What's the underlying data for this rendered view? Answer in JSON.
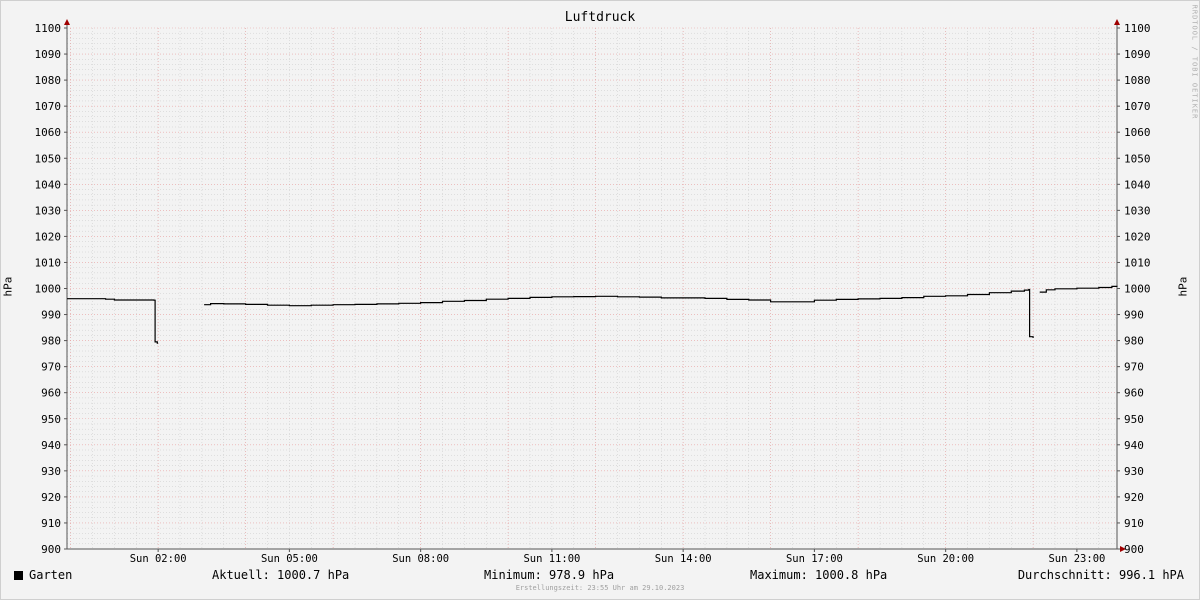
{
  "title": "Luftdruck",
  "watermark": "RRDTOOL / TOBI OETIKER",
  "footer": "Erstellungszeit: 23:55 Uhr am 29.10.2023",
  "legend": {
    "series_name": "Garten",
    "current": "Aktuell: 1000.7 hPa",
    "minimum": "Minimum: 978.9 hPa",
    "maximum": "Maximum: 1000.8 hPa",
    "average": "Durchschnitt: 996.1 hPA"
  },
  "colors": {
    "line": "#000000",
    "major_grid": "#e8a0a0",
    "minor_grid": "#c8c8c8",
    "axis": "#a00000"
  },
  "chart_data": {
    "type": "line",
    "title": "Luftdruck",
    "xlabel": "",
    "ylabel": "hPa",
    "ylabel_right": "hPa",
    "xlim": [
      "23:55",
      "23:55"
    ],
    "ylim": [
      900,
      1100
    ],
    "y_ticks": [
      900,
      910,
      920,
      930,
      940,
      950,
      960,
      970,
      980,
      990,
      1000,
      1010,
      1020,
      1030,
      1040,
      1050,
      1060,
      1070,
      1080,
      1090,
      1100
    ],
    "x_tick_labels": [
      "Sun 02:00",
      "Sun 05:00",
      "Sun 08:00",
      "Sun 11:00",
      "Sun 14:00",
      "Sun 17:00",
      "Sun 20:00",
      "Sun 23:00"
    ],
    "x_tick_hours": [
      2,
      5,
      8,
      11,
      14,
      17,
      20,
      23
    ],
    "x_range_hours": [
      -0.0833,
      23.9167
    ],
    "grid": true,
    "series": [
      {
        "name": "Garten",
        "segments": [
          {
            "x": [
              -0.08,
              0.3,
              0.8,
              1.0,
              1.9,
              1.92,
              1.93,
              1.98,
              2.0
            ],
            "y": [
              996.1,
              996.1,
              995.9,
              995.6,
              995.5,
              995.5,
              979.5,
              979.0,
              979.0
            ]
          },
          {
            "x": [
              3.05,
              3.2,
              3.5,
              4.0,
              4.5,
              5.0,
              5.5,
              6.0,
              6.5,
              7.0,
              7.5,
              8.0,
              8.5,
              9.0,
              9.5,
              10.0,
              10.5,
              11.0,
              11.5,
              12.0,
              12.5,
              13.0,
              13.5,
              14.0,
              14.5,
              15.0,
              15.5,
              16.0,
              16.5,
              17.0,
              17.5,
              18.0,
              18.5,
              19.0,
              19.5,
              20.0,
              20.5,
              21.0,
              21.5,
              21.8,
              21.9,
              21.92,
              22.0
            ],
            "y": [
              993.8,
              994.2,
              994.1,
              993.9,
              993.6,
              993.4,
              993.6,
              993.8,
              993.9,
              994.1,
              994.3,
              994.6,
              995.1,
              995.4,
              995.9,
              996.2,
              996.6,
              996.8,
              996.9,
              997.0,
              996.8,
              996.7,
              996.4,
              996.4,
              996.2,
              995.8,
              995.6,
              994.9,
              994.9,
              995.5,
              995.8,
              996.0,
              996.2,
              996.5,
              997.0,
              997.2,
              997.7,
              998.4,
              999.0,
              999.4,
              999.6,
              981.5,
              981.0
            ]
          },
          {
            "x": [
              22.15,
              22.3,
              22.5,
              23.0,
              23.5,
              23.8,
              23.9167
            ],
            "y": [
              998.6,
              999.5,
              999.9,
              1000.1,
              1000.4,
              1000.8,
              1000.7
            ]
          }
        ]
      }
    ]
  }
}
